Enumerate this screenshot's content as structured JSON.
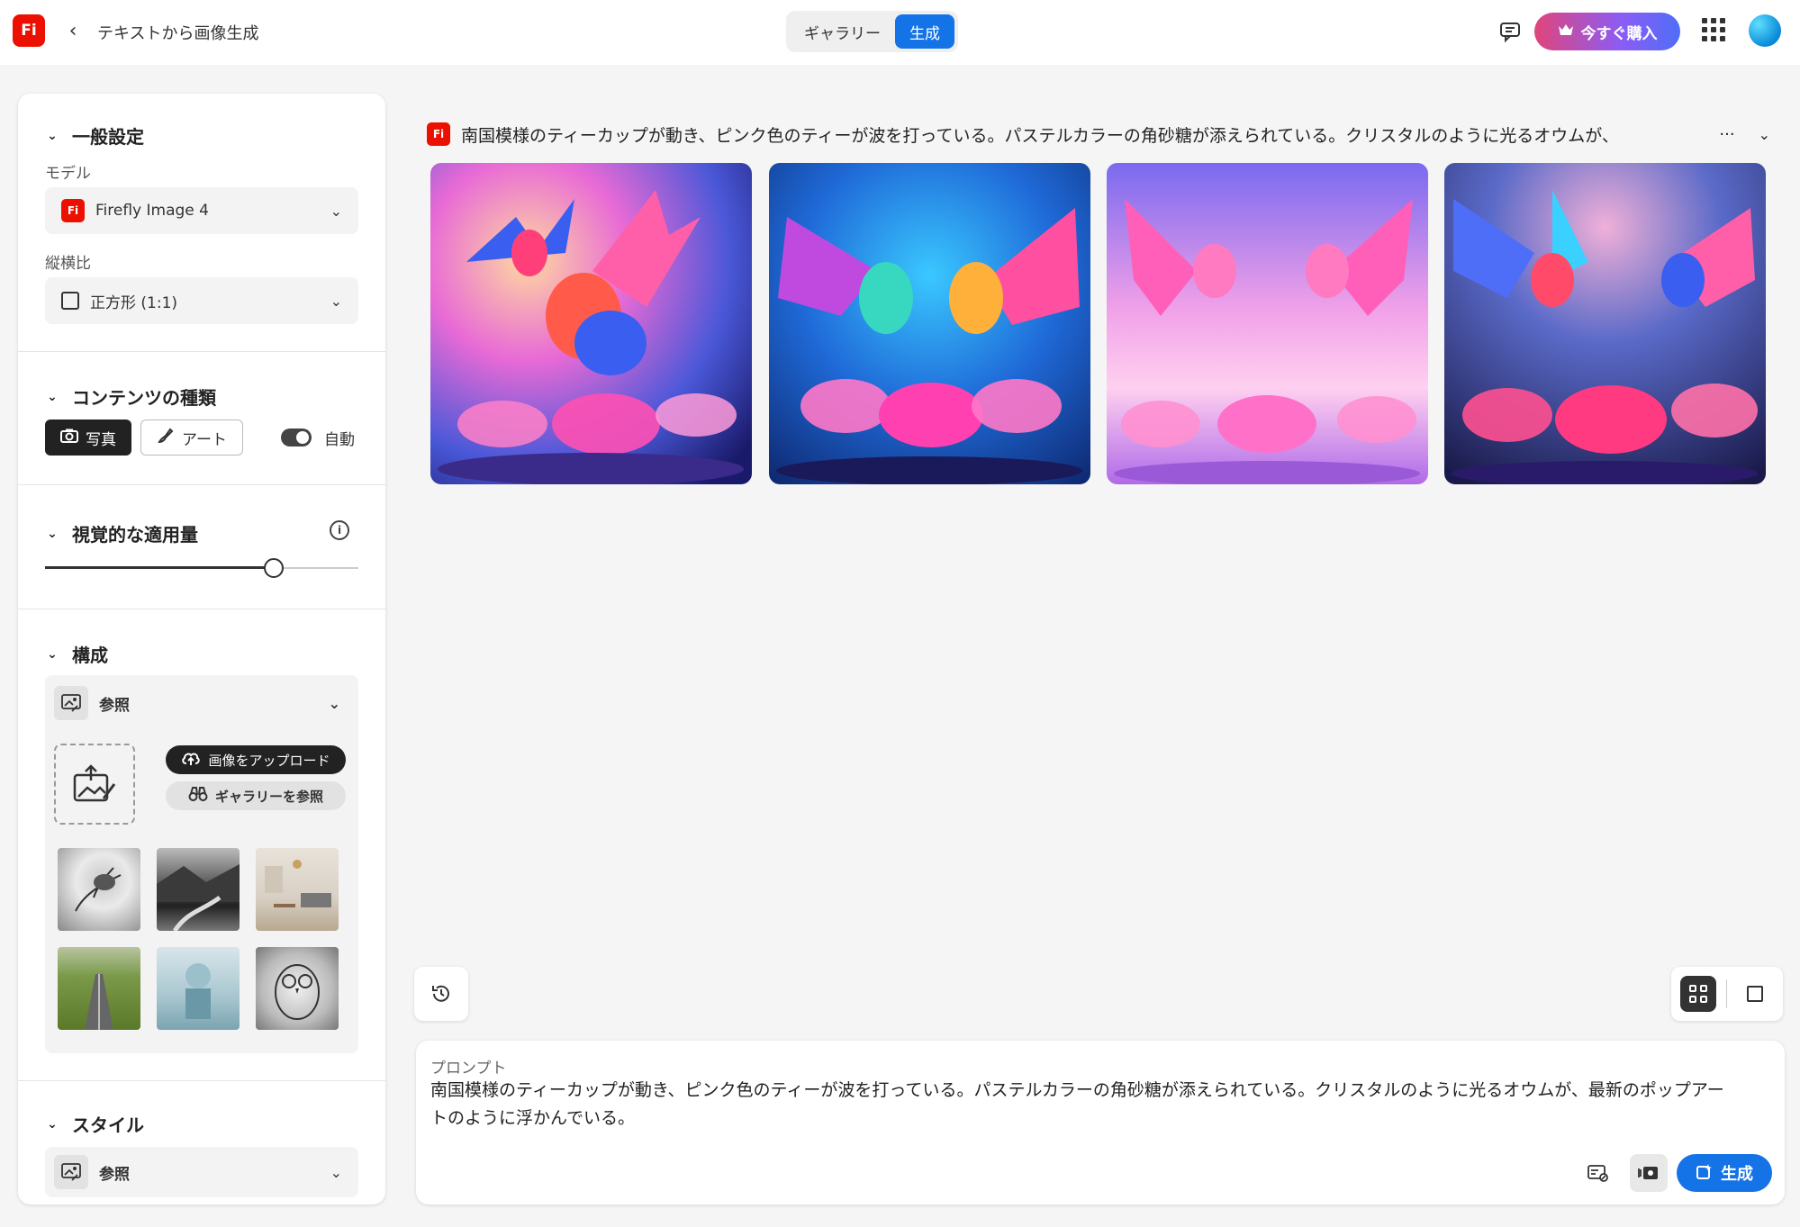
{
  "app": {
    "logo_text": "Fi",
    "title": "テキストから画像生成"
  },
  "header": {
    "tabs": [
      {
        "label": "ギャラリー",
        "active": false
      },
      {
        "label": "生成",
        "active": true
      }
    ],
    "buy_label": "今すぐ購入",
    "accent_color": "#1473e6"
  },
  "sidebar": {
    "general": {
      "title": "一般設定",
      "model_label": "モデル",
      "model_value": "Firefly Image 4",
      "aspect_label": "縦横比",
      "aspect_value": "正方形 (1:1)"
    },
    "content_type": {
      "title": "コンテンツの種類",
      "photo_label": "写真",
      "art_label": "アート",
      "auto_label": "自動",
      "auto_on": true
    },
    "visual_intensity": {
      "title": "視覚的な適用量",
      "value_fraction": 0.73
    },
    "composition": {
      "title": "構成",
      "reference_label": "参照",
      "upload_label": "画像をアップロード",
      "gallery_label": "ギャラリーを参照",
      "thumbnails": [
        "bird-sketch",
        "mountain-river",
        "living-room",
        "road-field",
        "sphere-sculpture",
        "owl-sketch"
      ]
    },
    "style": {
      "title": "スタイル",
      "reference_label": "参照"
    }
  },
  "results": {
    "prompt_summary": "南国模様のティーカップが動き、ピンク色のティーが波を打っている。パステルカラーの角砂糖が添えられている。クリスタルのように光るオウムが、",
    "more": "···",
    "images": [
      "parrots-teacups-1",
      "parrots-teacups-2",
      "parrots-teacups-3",
      "parrots-teacups-4"
    ]
  },
  "prompt_box": {
    "label": "プロンプト",
    "text": "南国模様のティーカップが動き、ピンク色のティーが波を打っている。パステルカラーの角砂糖が添えられている。クリスタルのように光るオウムが、最新のポップアートのように浮かんでいる。",
    "generate_label": "生成"
  }
}
